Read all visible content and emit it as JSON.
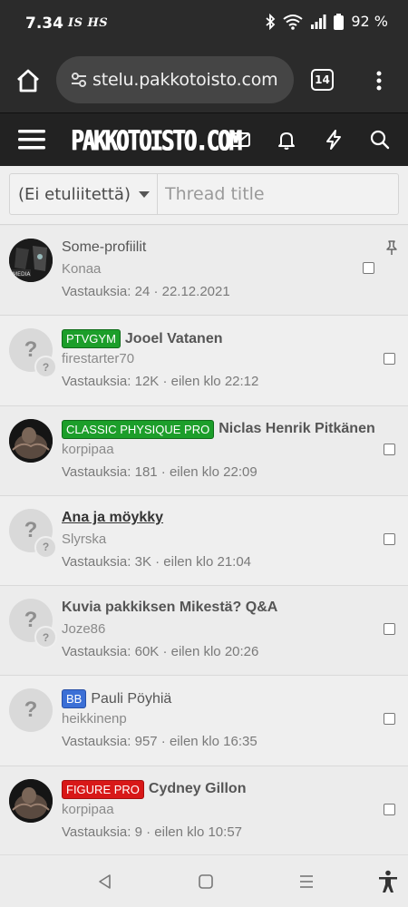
{
  "status_bar": {
    "time": "7.34",
    "notification_icons": "IS HS",
    "battery": "92 %"
  },
  "browser": {
    "url": "stelu.pakkotoisto.com",
    "tab_count": "14"
  },
  "site": {
    "logo": "PAKKOTOISTO.COM"
  },
  "filter": {
    "prefix_selected": "(Ei etuliitettä)",
    "title_placeholder": "Thread title"
  },
  "threads": [
    {
      "prefix": "",
      "prefix_color": "",
      "title": "Some-profiilit",
      "author": "Konaa",
      "meta": "Vastauksia: 24 · 22.12.2021",
      "pinned": true
    },
    {
      "prefix": "PTVGYM",
      "prefix_color": "#1c9e2a",
      "title": "Jooel Vatanen",
      "author": "firestarter70",
      "meta": "Vastauksia: 12K · eilen klo 22:12",
      "pinned": false
    },
    {
      "prefix": "CLASSIC PHYSIQUE PRO",
      "prefix_color": "#1c9e2a",
      "title": "Niclas Henrik Pitkänen",
      "author": "korpipaa",
      "meta": "Vastauksia: 181 · eilen klo 22:09",
      "pinned": false
    },
    {
      "prefix": "",
      "prefix_color": "",
      "title": "Ana ja möykky",
      "author": "Slyrska",
      "meta": "Vastauksia: 3K · eilen klo 21:04",
      "pinned": false
    },
    {
      "prefix": "",
      "prefix_color": "",
      "title": "Kuvia pakkiksen Mikestä? Q&A",
      "author": "Joze86",
      "meta": "Vastauksia: 60K · eilen klo 20:26",
      "pinned": false
    },
    {
      "prefix": "BB",
      "prefix_color": "#3b6fd6",
      "title": "Pauli Pöyhiä",
      "author": "heikkinenp",
      "meta": "Vastauksia: 957 · eilen klo 16:35",
      "pinned": false
    },
    {
      "prefix": "FIGURE PRO",
      "prefix_color": "#d81818",
      "title": "Cydney Gillon",
      "author": "korpipaa",
      "meta": "Vastauksia: 9 · eilen klo 10:57",
      "pinned": false
    }
  ],
  "placeholder_avatar_glyph": "?",
  "colors": {
    "header_bg": "#222222",
    "browser_bg": "#2b2b2b",
    "label_green": "#1c9e2a",
    "label_blue": "#3b6fd6",
    "label_red": "#d81818"
  }
}
